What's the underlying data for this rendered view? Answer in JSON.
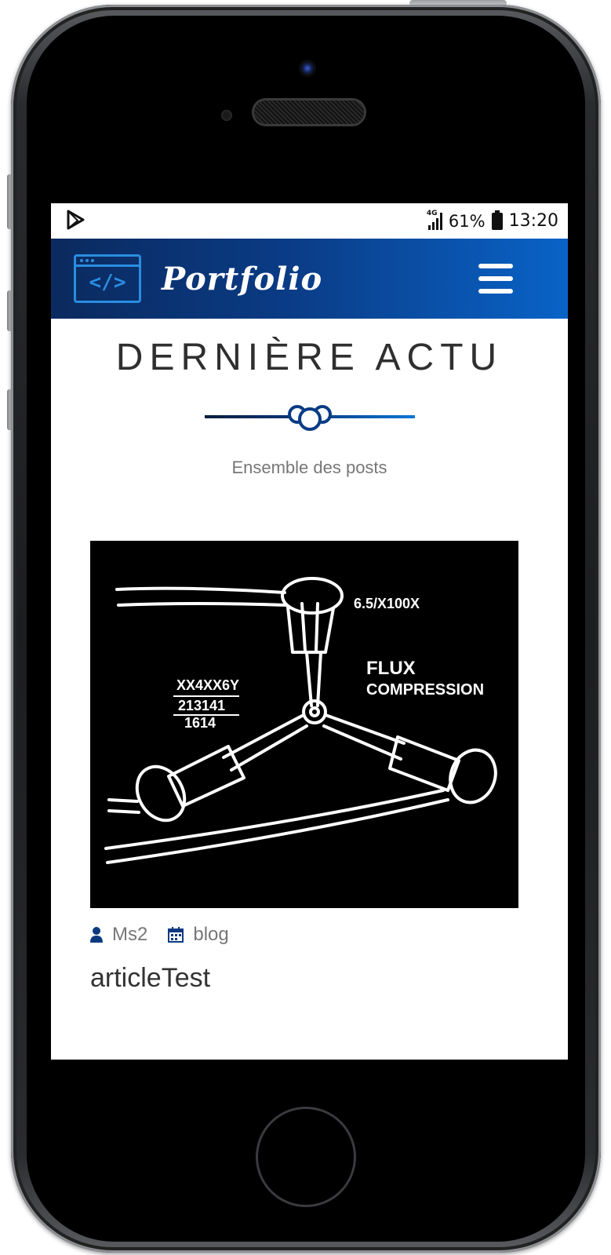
{
  "status_bar": {
    "network": "4G",
    "battery": "61%",
    "time": "13:20"
  },
  "navbar": {
    "logo_symbol": "</>",
    "brand": "Portfolio"
  },
  "section": {
    "title": "DERNIÈRE ACTU",
    "subtitle": "Ensemble des posts"
  },
  "post": {
    "image_texts": {
      "formula": "6.5/X100X",
      "flux": "FLUX",
      "compression": "COMPRESSION",
      "calc_line1": "XX4XX6Y",
      "calc_line2": "213141",
      "calc_line3": "1614"
    },
    "author": "Ms2",
    "category": "blog",
    "title": "articleTest"
  },
  "colors": {
    "nav_start": "#0b2a5e",
    "nav_end": "#0963c7",
    "accent": "#0a3b85"
  }
}
